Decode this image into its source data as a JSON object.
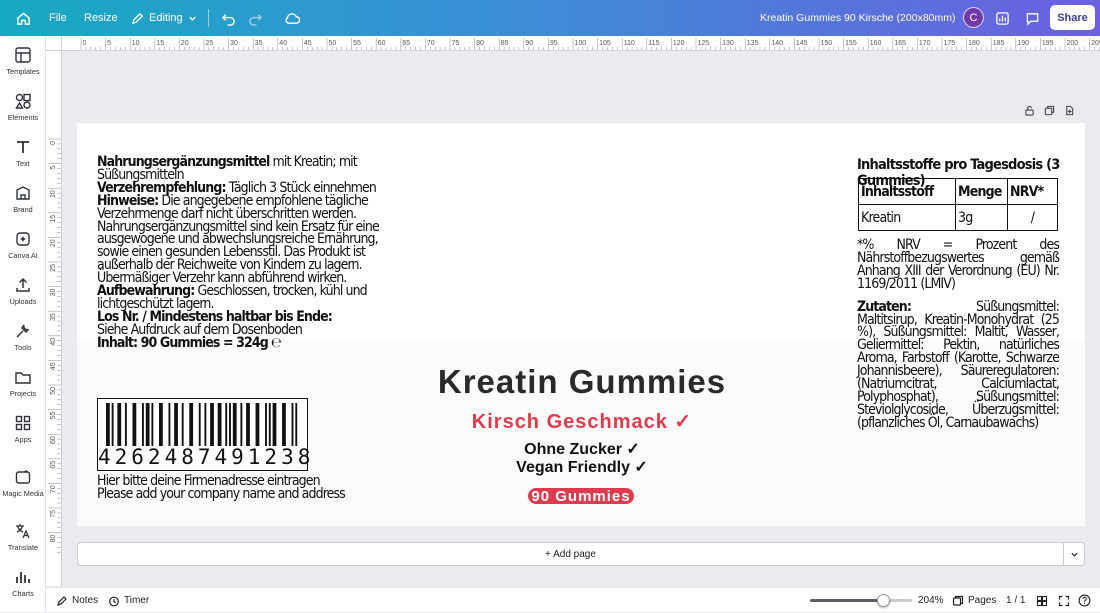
{
  "topbar": {
    "file": "File",
    "resize": "Resize",
    "mode": "Editing",
    "doc_title": "Kreatin Gummies 90 Kirsche (200x80mm)",
    "avatar_initial": "C",
    "share": "Share"
  },
  "sidebar": {
    "items": [
      {
        "label": "Templates",
        "icon": "templates-icon"
      },
      {
        "label": "Elements",
        "icon": "elements-icon"
      },
      {
        "label": "Text",
        "icon": "text-icon"
      },
      {
        "label": "Brand",
        "icon": "brand-icon"
      },
      {
        "label": "Canva AI",
        "icon": "canva-ai-icon"
      },
      {
        "label": "Uploads",
        "icon": "uploads-icon"
      },
      {
        "label": "Tools",
        "icon": "tools-icon"
      },
      {
        "label": "Projects",
        "icon": "projects-icon"
      },
      {
        "label": "Apps",
        "icon": "apps-icon"
      },
      {
        "label": "Magic Media",
        "icon": "magic-media-icon"
      },
      {
        "label": "Translate",
        "icon": "translate-icon"
      },
      {
        "label": "Charts",
        "icon": "charts-icon"
      }
    ]
  },
  "rulers": {
    "horizontal": [
      "0",
      "5",
      "10",
      "15",
      "20",
      "25",
      "30",
      "35",
      "40",
      "45",
      "50",
      "55",
      "60",
      "65",
      "70",
      "75",
      "80",
      "85",
      "90",
      "95",
      "100",
      "105",
      "110",
      "115",
      "120",
      "125",
      "130",
      "135",
      "140",
      "145",
      "150",
      "155",
      "160",
      "165",
      "170",
      "175",
      "180",
      "185",
      "190",
      "195",
      "200",
      "205"
    ],
    "vertical": [
      "0",
      "5",
      "10",
      "15",
      "20",
      "25",
      "30",
      "35",
      "40",
      "45",
      "50",
      "55",
      "60",
      "65",
      "70",
      "75",
      "80"
    ]
  },
  "label": {
    "left": {
      "p1_bold": "Nahrungsergänzungsmittel",
      "p1_rest": " mit Kreatin; mit Süßungsmitteln",
      "p2_bold": "Verzehrempfehlung:",
      "p2_rest": " Täglich 3 Stück einnehmen",
      "p3_bold": "Hinweise:",
      "p3_rest": " Die angegebene empfohlene tägliche Verzehrmenge darf nicht überschritten werden. Nahrungsergänzungsmittel sind kein Ersatz für eine ausgewogene und abwechslungsreiche Ernährung, sowie einen gesunden Lebensstil. Das Produkt ist außerhalb der Reichweite von Kindern zu lagern. Übermäßiger Verzehr kann abführend wirken.",
      "p4_bold": "Aufbewahrung:",
      "p4_rest": " Geschlossen, trocken, kühl und lichtgeschützt lagern.",
      "p5_bold": "Los Nr. / Mindestens haltbar bis Ende:",
      "p5_rest": "Siehe Aufdruck auf dem Dosenboden",
      "p6_bold": "Inhalt: 90 Gummies = 324g",
      "p6_symbol": "℮",
      "barcode_number": "4262487491238",
      "footer_line1": "Hier bitte deine Firmenadresse eintragen",
      "footer_line2": "Please add your company name and address"
    },
    "center": {
      "title": "Kreatin Gummies",
      "flavor": "Kirsch  Geschmack ✓",
      "claim1": "Ohne Zucker ✓",
      "claim2": "Vegan Friendly ✓",
      "pill": "90  Gummies"
    },
    "right": {
      "heading": "Inhaltsstoffe pro Tagesdosis (3 Gummies)",
      "table_header": [
        "Inhaltsstoff",
        "Menge",
        "NRV*"
      ],
      "table_rows": [
        [
          "Kreatin",
          "3g",
          "/"
        ]
      ],
      "nrv_note": "*% NRV = Prozent des Nährstoffbezugswertes gemäß Anhang XIII der Verordnung (EU) Nr. 1169/2011 (LMIV)",
      "ingredients_bold": "Zutaten:",
      "ingredients_rest": " Süßungsmittel: Maltitsirup, Kreatin-Monohydrat (25 %), Süßungsmittel: Maltit, Wasser, Geliermittel: Pektin, natürliches Aroma, Farbstoff (Karotte, Schwarze Johannisbeere), Säureregulatoren: (Natriumcitrat, Calciumlactat, Polyphosphat), Süßungsmittel: Steviolglycoside, Überzugsmittel: (pflanzliches Öl, Carnaubawachs)"
    }
  },
  "add_page": "+ Add page",
  "bottombar": {
    "notes": "Notes",
    "timer": "Timer",
    "zoom": "204%",
    "zoom_level": 0.72,
    "pages": "Pages",
    "page_counter": "1 / 1"
  },
  "colors": {
    "accent_red": "#e03b4d",
    "topbar_start": "#17a9c2",
    "topbar_end": "#6c5fe0"
  }
}
